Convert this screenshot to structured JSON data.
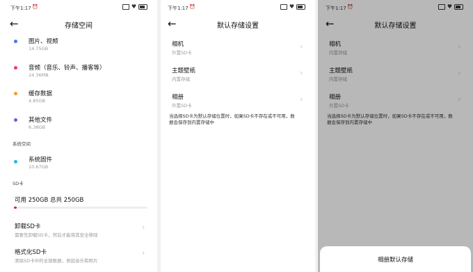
{
  "screen1": {
    "status": {
      "time": "下午1:17"
    },
    "title": "存储空间",
    "categories": [
      {
        "label": "图片、视频",
        "size": "14.75GB",
        "color": "#3d7bf0"
      },
      {
        "label": "音频（音乐、铃声、播客等）",
        "size": "24.36MB",
        "color": "#f03a5f"
      },
      {
        "label": "缓存数据",
        "size": "4.85GB",
        "color": "#f59b2a"
      },
      {
        "label": "其他文件",
        "size": "6.38GB",
        "color": "#6a5fd8"
      }
    ],
    "system_section": "系统空间",
    "system_item": {
      "label": "系统固件",
      "size": "10.67GB",
      "color": "#22b8e8"
    },
    "sd_section": "SD卡",
    "sd_capacity": "可用 250GB   总共 250GB",
    "sd_used_fraction": 0.01,
    "unmount": {
      "label": "卸载SD卡",
      "desc": "需要先卸载SD卡，然后才能将其安全移除"
    },
    "format": {
      "label": "格式化SD卡",
      "desc": "清除SD卡中的全部数据，例如音乐和照片"
    }
  },
  "screen2": {
    "status": {
      "time": "下午1:17"
    },
    "title": "默认存储设置",
    "items": [
      {
        "label": "相机",
        "value": "外置SD卡"
      },
      {
        "label": "主题壁纸",
        "value": "内置存储"
      },
      {
        "label": "相册",
        "value": "外置SD卡"
      }
    ],
    "note_line1": "当选择SD卡为默认存储位置时，如果SD卡不存在或不可用，数",
    "note_line2": "据会保存到内置存储中"
  },
  "screen3": {
    "status": {
      "time": "下午1:17"
    },
    "title": "默认存储设置",
    "items": [
      {
        "label": "相机",
        "value": "内置存储"
      },
      {
        "label": "主题壁纸",
        "value": "内置存储"
      },
      {
        "label": "相册",
        "value": "外置SD卡"
      }
    ],
    "note_line1": "当选择SD卡为默认存储位置时，如果SD卡不存在或不可用，数",
    "note_line2": "据会保存到内置存储中",
    "sheet_title": "相册默认存储"
  },
  "icons": {
    "back": "back-arrow-icon",
    "chevron": "chevron-right-icon",
    "alarm": "alarm-clock-icon"
  }
}
